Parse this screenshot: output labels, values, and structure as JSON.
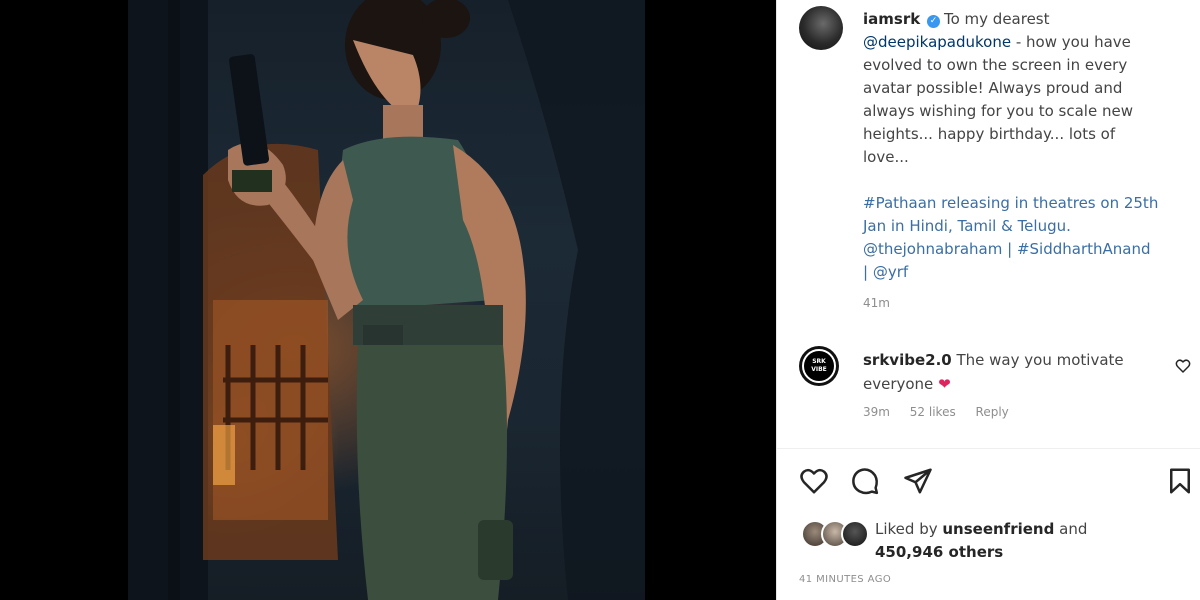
{
  "post": {
    "author": "iamsrk",
    "caption_lines": [
      "To my dearest",
      "@deepikapadukone",
      " - how you have",
      "evolved to own the screen in every",
      "avatar possible! Always proud and",
      "always wishing for you to scale new",
      "heights... happy birthday... lots of",
      "love...",
      "#Pathaan releasing in theatres on 25th",
      "Jan in Hindi, Tamil & Telugu.",
      "@thejohnabraham",
      " | ",
      "#SiddharthAnand",
      "| ",
      "@yrf"
    ],
    "caption_time": "41m"
  },
  "comment": {
    "user": "srkvibe2.0",
    "text": "The way you motivate everyone",
    "emoji": "❤",
    "avatar_text": "SRK VIBE",
    "time": "39m",
    "likes": "52 likes",
    "reply": "Reply"
  },
  "likes": {
    "prefix": "Liked by",
    "user": "unseenfriend",
    "suffix": "and",
    "others": "450,946 others"
  },
  "post_time": "41 MINUTES AGO",
  "colors": {
    "link_blue": "#00376b",
    "hashtag": "#3a6ea5",
    "verified": "#3897f0",
    "heart": "#e0245e"
  },
  "icons": {
    "like": "heart-outline-icon",
    "comment": "speech-bubble-icon",
    "share": "paper-plane-icon",
    "save": "bookmark-icon",
    "comment_like": "small-heart-icon",
    "verified": "verified-badge-icon"
  }
}
